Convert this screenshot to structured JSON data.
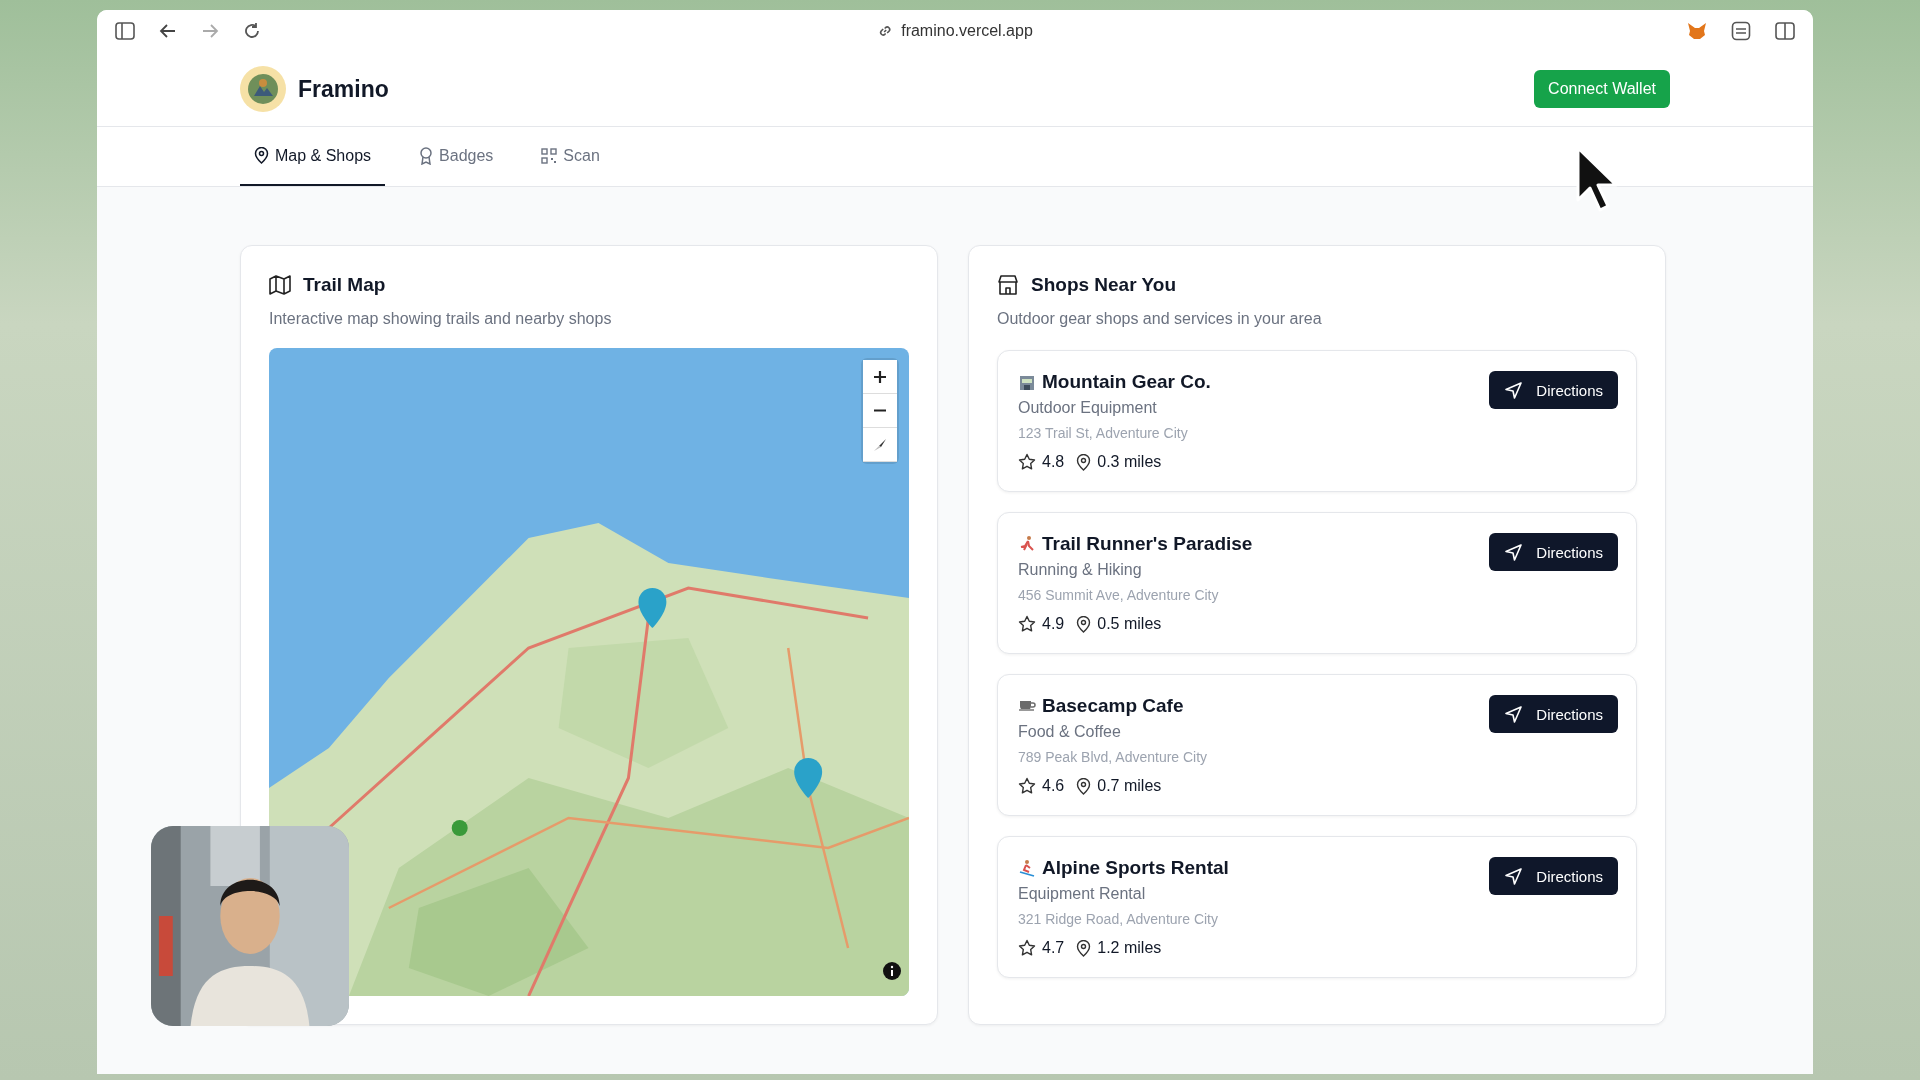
{
  "browser": {
    "url": "framino.vercel.app"
  },
  "app": {
    "name": "Framino",
    "connect_button": "Connect Wallet"
  },
  "tabs": [
    {
      "label": "Map & Shops",
      "kind": "pin",
      "selected": true
    },
    {
      "label": "Badges",
      "kind": "badge",
      "selected": false
    },
    {
      "label": "Scan",
      "kind": "qr",
      "selected": false
    }
  ],
  "map_card": {
    "title": "Trail Map",
    "subtitle": "Interactive map showing trails and nearby shops"
  },
  "shops_card": {
    "title": "Shops Near You",
    "subtitle": "Outdoor gear shops and services in your area",
    "shops": [
      {
        "kind": "store",
        "name": "Mountain Gear Co.",
        "category": "Outdoor Equipment",
        "address": "123 Trail St, Adventure City",
        "rating": "4.8",
        "distance": "0.3 miles",
        "button": "Directions"
      },
      {
        "kind": "runner",
        "name": "Trail Runner's Paradise",
        "category": "Running & Hiking",
        "address": "456 Summit Ave, Adventure City",
        "rating": "4.9",
        "distance": "0.5 miles",
        "button": "Directions"
      },
      {
        "kind": "cafe",
        "name": "Basecamp Cafe",
        "category": "Food & Coffee",
        "address": "789 Peak Blvd, Adventure City",
        "rating": "4.6",
        "distance": "0.7 miles",
        "button": "Directions"
      },
      {
        "kind": "skier",
        "name": "Alpine Sports Rental",
        "category": "Equipment Rental",
        "address": "321 Ridge Road, Adventure City",
        "rating": "4.7",
        "distance": "1.2 miles",
        "button": "Directions"
      }
    ]
  }
}
